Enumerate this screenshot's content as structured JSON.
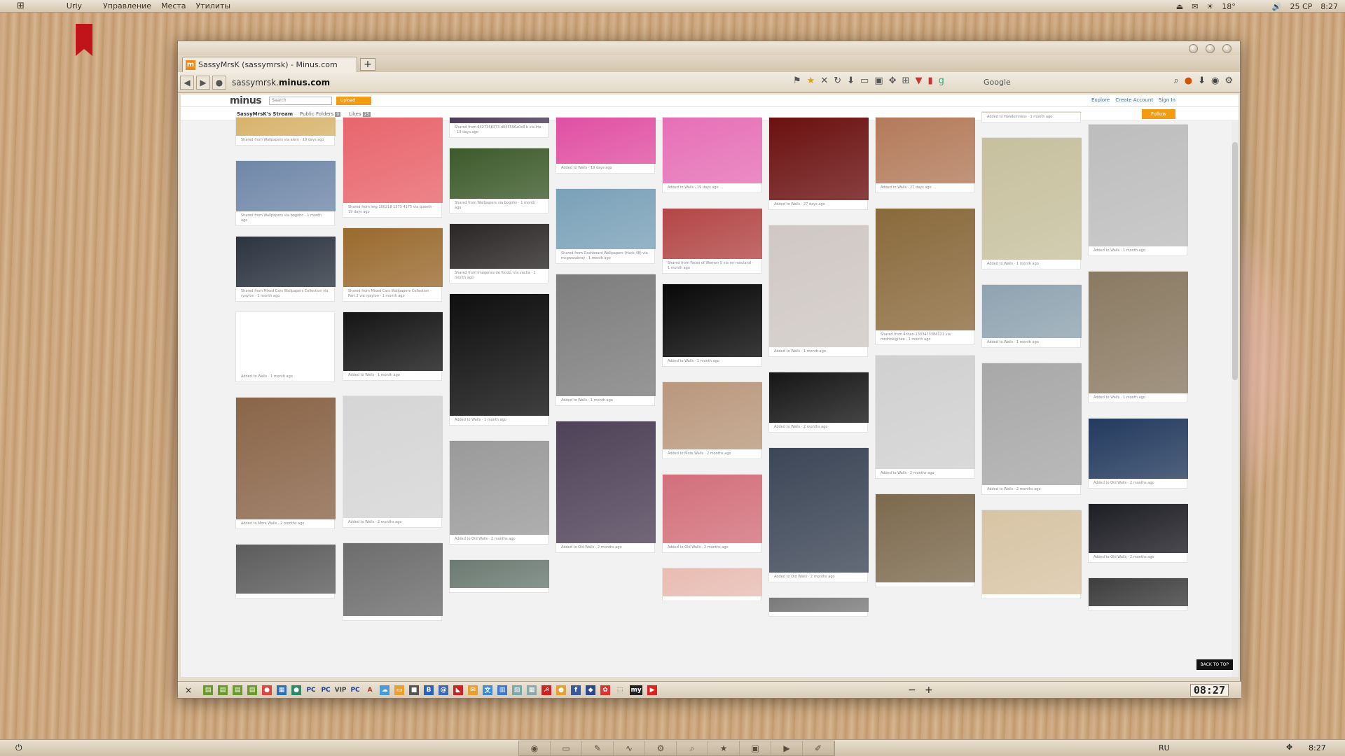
{
  "topbar": {
    "user": "Uriy",
    "menus": [
      "Управление",
      "Места",
      "Утилиты"
    ],
    "weather": "18°",
    "date": "25 СР",
    "time": "8:27"
  },
  "browser": {
    "tab_title": "SassyMrsK (sassymrsk) - Minus.com",
    "new_tab": "+",
    "url_prefix": "sassymrsk.",
    "url_domain": "minus.com",
    "search_engine": "Google"
  },
  "site": {
    "logo": "minus",
    "search_placeholder": "Search",
    "upload": "Upload",
    "links": [
      "Explore",
      "Create Account",
      "Sign In"
    ],
    "stream": "SassyMrsK's Stream",
    "public_folders": "Public Folders",
    "public_count": "9",
    "likes": "Likes",
    "likes_count": "25",
    "follow": "Follow",
    "back_to_top": "BACK TO TOP"
  },
  "tiles": [
    {
      "c": "Shared from Wallpapers via alem · 19 days ago",
      "col": "#d7b26a"
    },
    {
      "c": "Shared from Wallpapers via bogohn · 1 month ago",
      "col": "#6f87a8"
    },
    {
      "c": "Shared from Mixed Cars Wallpapers Collection via ryaylon · 1 month ago",
      "col": "#2c3440"
    },
    {
      "c": "Added to Walls · 1 month ago",
      "col": "#111"
    },
    {
      "c": "Added to More Walls · 2 months ago",
      "col": "#8a6548"
    },
    {
      "c": "",
      "col": "#5c5c5c"
    },
    {
      "c": "Shared from img 100218 1373 4175 via queeth · 19 days ago",
      "col": "#e8656c"
    },
    {
      "c": "Shared from Mixed Cars Wallpapers Collection - Part 2 via ryaylon · 1 month ago",
      "col": "#9a6a2e"
    },
    {
      "c": "Added to Walls · 1 month ago",
      "col": "#151515"
    },
    {
      "c": "Added to Walls · 2 months ago",
      "col": "#d5d5d5"
    },
    {
      "c": "",
      "col": "#6d6d6d"
    },
    {
      "c": "Shared from 6427358373 d045596a0c8 b via Irie · 19 days ago",
      "col": "#4b3a52"
    },
    {
      "c": "Shared from Wallpapers via bogohn · 1 month ago",
      "col": "#3d5a2a"
    },
    {
      "c": "Shared from Imágenes de fondo, via vacha · 1 month ago",
      "col": "#2a2626"
    },
    {
      "c": "Added to Walls · 1 month ago",
      "col": "#0f0f0f"
    },
    {
      "c": "Added to Old Walls · 2 months ago",
      "col": "#9a9a9a"
    },
    {
      "c": "",
      "col": "#6b7a72"
    },
    {
      "c": "Added to Walls · 19 days ago",
      "col": "#e04fa2"
    },
    {
      "c": "Shared from Dashboard Wallpapers (Hack 48) via mcgwarabroy · 1 month ago",
      "col": "#7aa1b8"
    },
    {
      "c": "Added to Walls · 1 month ago",
      "col": "#7d7d7d"
    },
    {
      "c": "Added to Old Walls · 2 months ago",
      "col": "#4f4258"
    },
    {
      "c": "Added to Walls · 19 days ago",
      "col": "#e66fb6"
    },
    {
      "c": "Shared from Faces of Women 5 via mr mouland · 1 month ago",
      "col": "#b34646"
    },
    {
      "c": "Added to Walls · 1 month ago",
      "col": "#080808"
    },
    {
      "c": "Added to More Walls · 2 months ago",
      "col": "#b9987c"
    },
    {
      "c": "Added to Old Walls · 2 months ago",
      "col": "#d26f7b"
    },
    {
      "c": "",
      "col": "#e8bcb2"
    },
    {
      "c": "Added to Walls · 27 days ago",
      "col": "#6b1010"
    },
    {
      "c": "Added to Walls · 1 month ago",
      "col": "#cfc8c4"
    },
    {
      "c": "Added to Walls · 2 months ago",
      "col": "#161616"
    },
    {
      "c": "Added to Old Walls · 2 months ago",
      "col": "#3c4656"
    },
    {
      "c": "",
      "col": "#7a7a7a"
    },
    {
      "c": "Added to Walls · 27 days ago",
      "col": "#b37a5a"
    },
    {
      "c": "Shared from 4chan-1333473384121 via mrdrinkigihee · 1 month ago",
      "col": "#8a6a3c"
    },
    {
      "c": "Added to Walls · 2 months ago",
      "col": "#d0d0d0"
    },
    {
      "c": "",
      "col": "#7c6a4e"
    },
    {
      "c": "Added to Handomness · 1 month ago",
      "col": "#d8d0c0"
    },
    {
      "c": "Added to Walls · 1 month ago",
      "col": "#c7c09e"
    },
    {
      "c": "Added to Walls · 1 month ago",
      "col": "#8fa3b0"
    },
    {
      "c": "Added to Walls · 2 months ago",
      "col": "#a8a8a8"
    },
    {
      "c": "",
      "col": "#d8c4a4"
    },
    {
      "c": "Added to Walls · 1 month ago",
      "col": "#bdbdbd"
    },
    {
      "c": "Added to Walls · 1 month ago",
      "col": "#8a7a62"
    },
    {
      "c": "Added to Old Walls · 2 months ago",
      "col": "#233a5e"
    },
    {
      "c": "Added to Old Walls · 2 months ago",
      "col": "#1d1d24"
    },
    {
      "c": "",
      "col": "#3d3d3d"
    }
  ],
  "addon_bar": {
    "clock": "08:27",
    "close": "×",
    "zoom_out": "−",
    "zoom_in": "+"
  },
  "dock": {
    "lang": "RU",
    "time": "8:27"
  }
}
